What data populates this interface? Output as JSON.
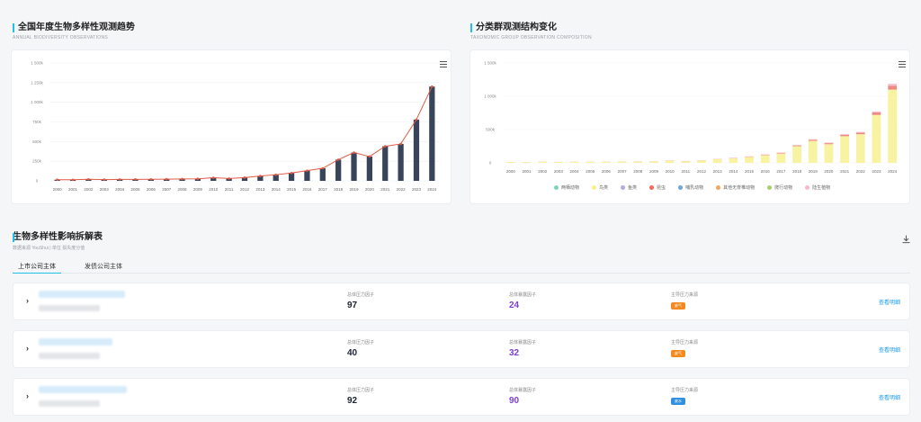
{
  "trend": {
    "title": "全国年度生物多样性观测趋势",
    "subtitle": "ANNUAL BIODIVERSITY OBSERVATIONS"
  },
  "taxon": {
    "title": "分类群观测结构变化",
    "subtitle": "TAXONOMIC GROUP OBSERVATION COMPOSITION",
    "legend": [
      {
        "label": "两栖动物",
        "color": "#7fd3b8"
      },
      {
        "label": "鸟类",
        "color": "#f7f08a"
      },
      {
        "label": "鱼类",
        "color": "#b7a9e0"
      },
      {
        "label": "昆虫",
        "color": "#f06a5a"
      },
      {
        "label": "哺乳动物",
        "color": "#6aa6d8"
      },
      {
        "label": "其他无脊椎动物",
        "color": "#f2a65a"
      },
      {
        "label": "爬行动物",
        "color": "#a6d16a"
      },
      {
        "label": "陆生植物",
        "color": "#f5b8d0"
      }
    ]
  },
  "impact": {
    "title": "生物多样性影响拆解表",
    "subtitle": "数据来源 YouShui | 单位 损失度分值",
    "tabs": [
      "上市公司主体",
      "发债公司主体"
    ],
    "rows": [
      {
        "pressure_label": "总体压力因子",
        "pressure": "97",
        "exposure_label": "总体暴露因子",
        "exposure": "24",
        "source_label": "主导压力来源",
        "source": "废气",
        "source_color": "#f28a1f",
        "detail": "查看明细"
      },
      {
        "pressure_label": "总体压力因子",
        "pressure": "40",
        "exposure_label": "总体暴露因子",
        "exposure": "32",
        "source_label": "主导压力来源",
        "source": "废气",
        "source_color": "#f28a1f",
        "detail": "查看明细"
      },
      {
        "pressure_label": "总体压力因子",
        "pressure": "92",
        "exposure_label": "总体暴露因子",
        "exposure": "90",
        "source_label": "主导压力来源",
        "source": "废水",
        "source_color": "#2f8fe0",
        "detail": "查看明细"
      }
    ]
  },
  "chart_data": [
    {
      "type": "bar",
      "years": [
        "2000",
        "2001",
        "2002",
        "2003",
        "2004",
        "2005",
        "2006",
        "2007",
        "2008",
        "2009",
        "2010",
        "2011",
        "2012",
        "2013",
        "2014",
        "2015",
        "2016",
        "2017",
        "2018",
        "2019",
        "2020",
        "2021",
        "2022",
        "2023",
        "2024"
      ],
      "yticks": [
        "0",
        "250k",
        "500k",
        "750k",
        "1 000k",
        "1 250k",
        "1 500k"
      ],
      "ylim": [
        0,
        1500000
      ],
      "values": [
        15000,
        14000,
        20000,
        16000,
        18000,
        19000,
        20000,
        22000,
        24000,
        26000,
        40000,
        30000,
        42000,
        62000,
        78000,
        100000,
        130000,
        160000,
        270000,
        360000,
        310000,
        440000,
        470000,
        780000,
        1200000
      ],
      "line_color": "#e05a44",
      "bar_color": "#37445a"
    },
    {
      "type": "bar",
      "stacked": true,
      "years": [
        "2000",
        "2001",
        "2002",
        "2003",
        "2004",
        "2005",
        "2006",
        "2007",
        "2008",
        "2009",
        "2010",
        "2011",
        "2012",
        "2013",
        "2014",
        "2015",
        "2016",
        "2017",
        "2018",
        "2019",
        "2020",
        "2021",
        "2022",
        "2023",
        "2024"
      ],
      "yticks": [
        "0",
        "500k",
        "1 000k",
        "1 500k"
      ],
      "ylim": [
        0,
        1500000
      ],
      "series": [
        {
          "name": "鸟类",
          "color": "#f7f3a0",
          "values": [
            12000,
            11000,
            17000,
            13000,
            15000,
            16000,
            17000,
            19000,
            20000,
            22000,
            34000,
            25000,
            36000,
            54000,
            68000,
            88000,
            115000,
            140000,
            250000,
            330000,
            280000,
            400000,
            430000,
            720000,
            1100000
          ]
        },
        {
          "name": "昆虫",
          "color": "#f08a80",
          "values": [
            1000,
            1000,
            1000,
            1000,
            1000,
            1000,
            1000,
            1000,
            1000,
            1000,
            2000,
            2000,
            2000,
            3000,
            4000,
            5000,
            6000,
            8000,
            12000,
            16000,
            16000,
            20000,
            22000,
            38000,
            60000
          ]
        },
        {
          "name": "陆生植物",
          "color": "#f5c4d6",
          "values": [
            1000,
            1000,
            1000,
            1000,
            1000,
            1000,
            1000,
            1000,
            2000,
            2000,
            2000,
            2000,
            2000,
            3000,
            4000,
            5000,
            6000,
            8000,
            6000,
            10000,
            10000,
            14000,
            14000,
            16000,
            30000
          ]
        }
      ]
    }
  ]
}
